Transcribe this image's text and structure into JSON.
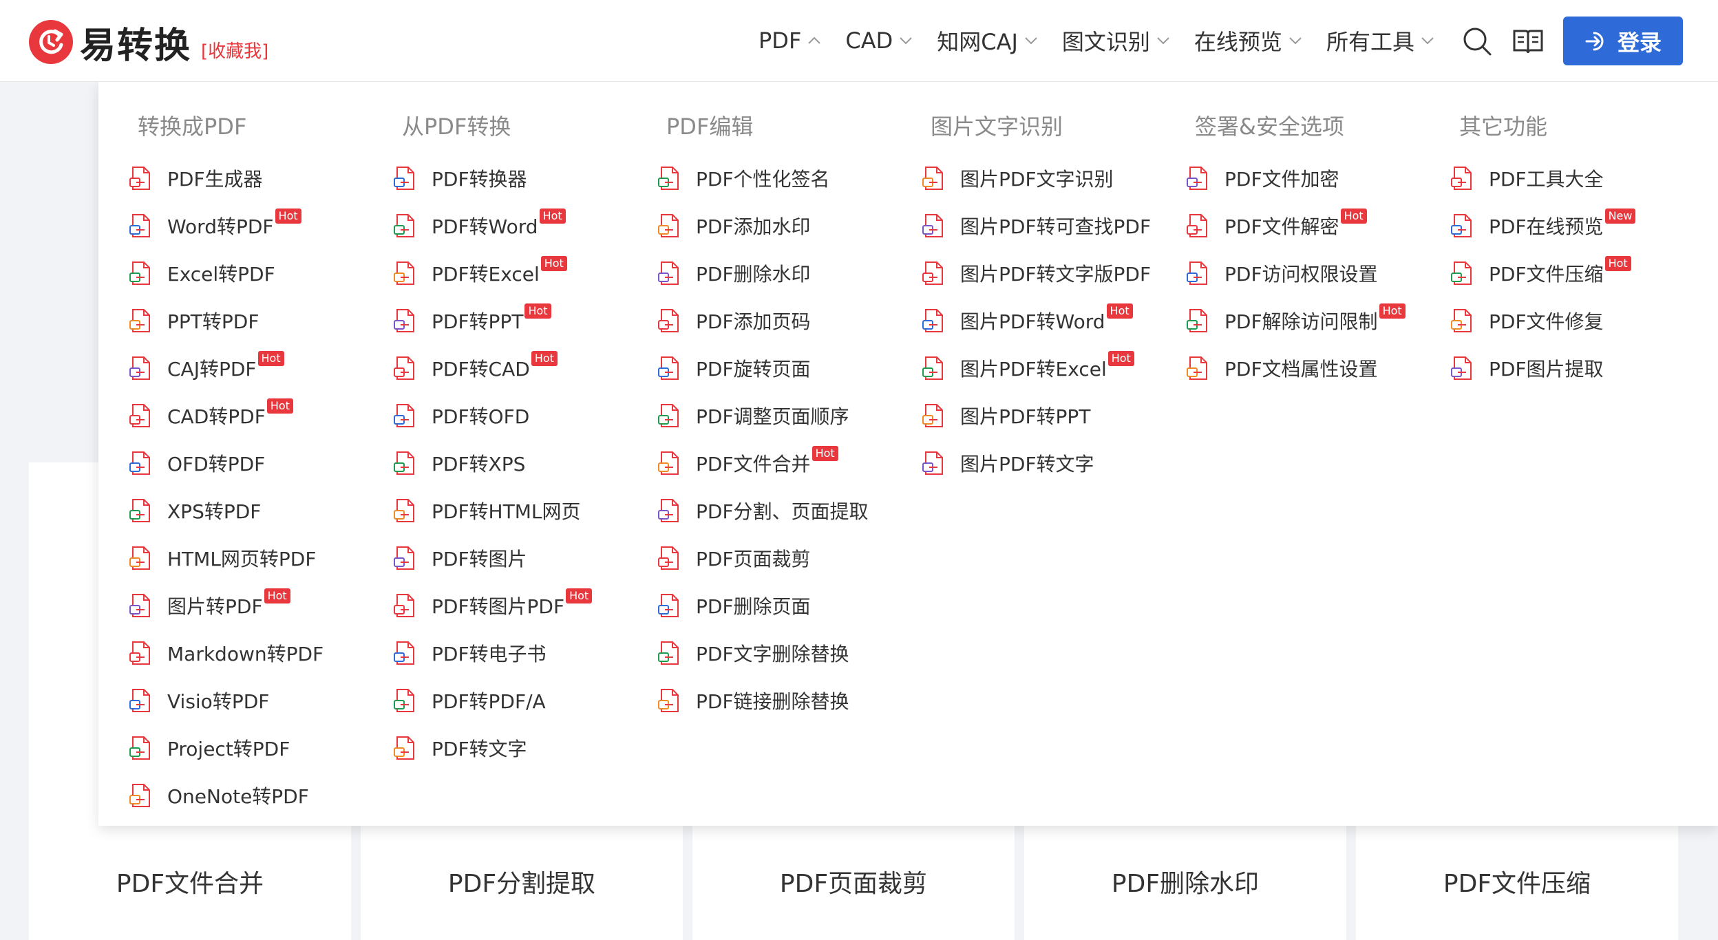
{
  "logo": {
    "name": "易转换",
    "bookmark": "[收藏我]"
  },
  "nav": [
    {
      "label": "PDF",
      "expanded": true
    },
    {
      "label": "CAD"
    },
    {
      "label": "知网CAJ"
    },
    {
      "label": "图文识别"
    },
    {
      "label": "在线预览"
    },
    {
      "label": "所有工具"
    }
  ],
  "header_icons": [
    "search-icon",
    "book-icon"
  ],
  "login": {
    "label": "登录"
  },
  "colors": {
    "accent": "#e8383d",
    "primary": "#2f6bd8"
  },
  "dropdown": {
    "columns": [
      {
        "title": "转换成PDF",
        "items": [
          {
            "label": "PDF生成器",
            "icon": "pdf-generator-icon"
          },
          {
            "label": "Word转PDF",
            "badge": "Hot",
            "icon": "word-file-icon"
          },
          {
            "label": "Excel转PDF",
            "icon": "excel-file-icon"
          },
          {
            "label": "PPT转PDF",
            "icon": "ppt-file-icon"
          },
          {
            "label": "CAJ转PDF",
            "badge": "Hot",
            "icon": "caj-file-icon"
          },
          {
            "label": "CAD转PDF",
            "badge": "Hot",
            "icon": "cad-file-icon"
          },
          {
            "label": "OFD转PDF",
            "icon": "ofd-file-icon"
          },
          {
            "label": "XPS转PDF",
            "icon": "xps-file-icon"
          },
          {
            "label": "HTML网页转PDF",
            "icon": "html-file-icon"
          },
          {
            "label": "图片转PDF",
            "badge": "Hot",
            "icon": "image-file-icon"
          },
          {
            "label": "Markdown转PDF",
            "icon": "markdown-file-icon"
          },
          {
            "label": "Visio转PDF",
            "icon": "visio-file-icon"
          },
          {
            "label": "Project转PDF",
            "icon": "project-file-icon"
          },
          {
            "label": "OneNote转PDF",
            "icon": "onenote-file-icon"
          }
        ]
      },
      {
        "title": "从PDF转换",
        "items": [
          {
            "label": "PDF转换器",
            "icon": "pdf-converter-icon"
          },
          {
            "label": "PDF转Word",
            "badge": "Hot",
            "icon": "pdf-to-word-icon"
          },
          {
            "label": "PDF转Excel",
            "badge": "Hot",
            "icon": "pdf-to-excel-icon"
          },
          {
            "label": "PDF转PPT",
            "badge": "Hot",
            "icon": "pdf-to-ppt-icon"
          },
          {
            "label": "PDF转CAD",
            "badge": "Hot",
            "icon": "pdf-to-cad-icon"
          },
          {
            "label": "PDF转OFD",
            "icon": "pdf-to-ofd-icon"
          },
          {
            "label": "PDF转XPS",
            "icon": "pdf-to-xps-icon"
          },
          {
            "label": "PDF转HTML网页",
            "icon": "pdf-to-html-icon"
          },
          {
            "label": "PDF转图片",
            "icon": "pdf-to-image-icon"
          },
          {
            "label": "PDF转图片PDF",
            "badge": "Hot",
            "icon": "pdf-to-image-pdf-icon"
          },
          {
            "label": "PDF转电子书",
            "icon": "pdf-to-ebook-icon"
          },
          {
            "label": "PDF转PDF/A",
            "icon": "pdf-to-pdfa-icon"
          },
          {
            "label": "PDF转文字",
            "icon": "pdf-to-text-icon"
          }
        ]
      },
      {
        "title": "PDF编辑",
        "items": [
          {
            "label": "PDF个性化签名",
            "icon": "signature-icon"
          },
          {
            "label": "PDF添加水印",
            "icon": "add-watermark-icon"
          },
          {
            "label": "PDF删除水印",
            "icon": "remove-watermark-icon"
          },
          {
            "label": "PDF添加页码",
            "icon": "page-number-icon"
          },
          {
            "label": "PDF旋转页面",
            "icon": "rotate-icon"
          },
          {
            "label": "PDF调整页面顺序",
            "icon": "reorder-icon"
          },
          {
            "label": "PDF文件合并",
            "badge": "Hot",
            "icon": "merge-icon"
          },
          {
            "label": "PDF分割、页面提取",
            "icon": "split-icon"
          },
          {
            "label": "PDF页面裁剪",
            "icon": "crop-icon"
          },
          {
            "label": "PDF删除页面",
            "icon": "delete-page-icon"
          },
          {
            "label": "PDF文字删除替换",
            "icon": "text-replace-icon"
          },
          {
            "label": "PDF链接删除替换",
            "icon": "link-replace-icon"
          }
        ]
      },
      {
        "title": "图片文字识别",
        "items": [
          {
            "label": "图片PDF文字识别",
            "icon": "ocr-icon"
          },
          {
            "label": "图片PDF转可查找PDF",
            "icon": "searchable-pdf-icon"
          },
          {
            "label": "图片PDF转文字版PDF",
            "icon": "text-pdf-icon"
          },
          {
            "label": "图片PDF转Word",
            "badge": "Hot",
            "icon": "image-pdf-word-icon"
          },
          {
            "label": "图片PDF转Excel",
            "badge": "Hot",
            "icon": "image-pdf-excel-icon"
          },
          {
            "label": "图片PDF转PPT",
            "icon": "image-pdf-ppt-icon"
          },
          {
            "label": "图片PDF转文字",
            "icon": "image-pdf-text-icon"
          }
        ]
      },
      {
        "title": "签署&安全选项",
        "items": [
          {
            "label": "PDF文件加密",
            "icon": "shield-icon"
          },
          {
            "label": "PDF文件解密",
            "badge": "Hot",
            "icon": "lock-icon"
          },
          {
            "label": "PDF访问权限设置",
            "icon": "permission-shield-icon"
          },
          {
            "label": "PDF解除访问限制",
            "badge": "Hot",
            "icon": "unlock-icon"
          },
          {
            "label": "PDF文档属性设置",
            "icon": "properties-icon"
          }
        ]
      },
      {
        "title": "其它功能",
        "items": [
          {
            "label": "PDF工具大全",
            "icon": "pdf-tools-icon"
          },
          {
            "label": "PDF在线预览",
            "badge": "New",
            "icon": "pdf-preview-icon"
          },
          {
            "label": "PDF文件压缩",
            "badge": "Hot",
            "icon": "compress-icon"
          },
          {
            "label": "PDF文件修复",
            "icon": "repair-icon"
          },
          {
            "label": "PDF图片提取",
            "icon": "extract-image-icon"
          }
        ]
      }
    ]
  },
  "bottom_tabs": [
    {
      "label": "PDF文件合并"
    },
    {
      "label": "PDF分割提取"
    },
    {
      "label": "PDF页面裁剪"
    },
    {
      "label": "PDF删除水印"
    },
    {
      "label": "PDF文件压缩"
    }
  ]
}
